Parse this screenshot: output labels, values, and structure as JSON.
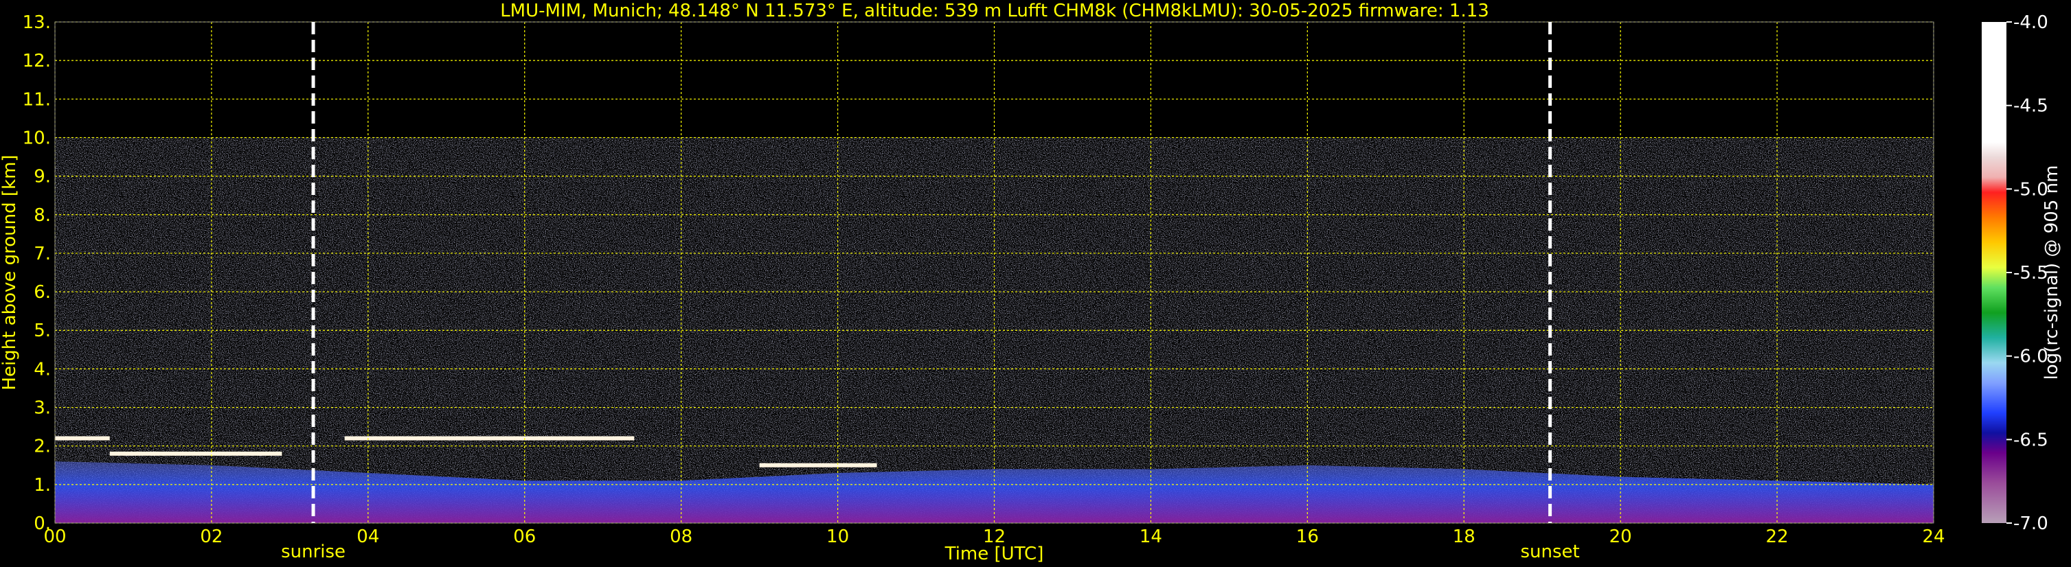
{
  "chart_data": {
    "type": "heatmap",
    "title": "LMU-MIM, Munich; 48.148° N 11.573° E, altitude: 539 m    Lufft CHM8k (CHM8kLMU): 30-05-2025    firmware: 1.13",
    "xlabel": "Time [UTC]",
    "ylabel": "Height above ground [km]",
    "xlim": [
      0,
      24
    ],
    "ylim": [
      0,
      13
    ],
    "x_ticks": [
      "00",
      "02",
      "04",
      "06",
      "08",
      "10",
      "12",
      "14",
      "16",
      "18",
      "20",
      "22",
      "24"
    ],
    "y_ticks": [
      "0.",
      "1.",
      "2.",
      "3.",
      "4.",
      "5.",
      "6.",
      "7.",
      "8.",
      "9.",
      "10.",
      "11.",
      "12.",
      "13."
    ],
    "grid": true,
    "data_max_height_km": 10,
    "events": [
      {
        "label": "sunrise",
        "time_utc": 3.3
      },
      {
        "label": "sunset",
        "time_utc": 19.1
      }
    ],
    "colorbar": {
      "label": "log(rc-signal) @ 905 nm",
      "range": [
        -7.0,
        -4.0
      ],
      "ticks": [
        "-4.0",
        "-4.5",
        "-5.0",
        "-5.5",
        "-6.0",
        "-6.5",
        "-7.0"
      ]
    },
    "cloud_layers": [
      {
        "start": 0.0,
        "end": 0.7,
        "height_km": 2.2
      },
      {
        "start": 0.7,
        "end": 2.9,
        "height_km": 1.8
      },
      {
        "start": 3.7,
        "end": 7.4,
        "height_km": 2.2
      },
      {
        "start": 9.0,
        "end": 10.5,
        "height_km": 1.5
      }
    ],
    "boundary_layer_top_km": [
      [
        0,
        1.6
      ],
      [
        2,
        1.5
      ],
      [
        4,
        1.3
      ],
      [
        6,
        1.1
      ],
      [
        8,
        1.1
      ],
      [
        10,
        1.3
      ],
      [
        12,
        1.4
      ],
      [
        14,
        1.4
      ],
      [
        16,
        1.5
      ],
      [
        18,
        1.4
      ],
      [
        20,
        1.2
      ],
      [
        22,
        1.1
      ],
      [
        24,
        1.0
      ]
    ]
  },
  "colors": {
    "axis_text": "#ffff00",
    "grid": "#ffff00",
    "background": "#000000",
    "event_line": "#ffffff"
  }
}
